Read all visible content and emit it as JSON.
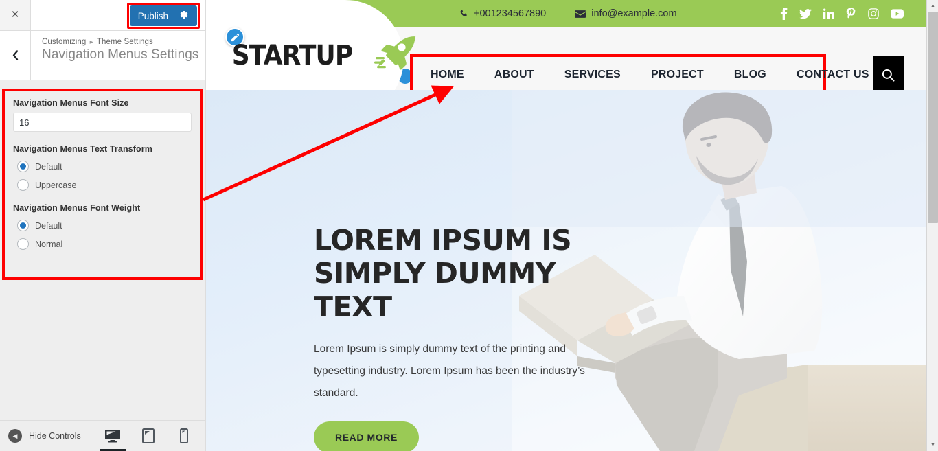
{
  "customizer": {
    "close_label": "×",
    "publish_label": "Publish",
    "gear_icon": "gear-icon",
    "back_icon": "chevron-left-icon",
    "breadcrumb_root": "Customizing",
    "breadcrumb_sep": "▸",
    "breadcrumb_parent": "Theme Settings",
    "panel_title": "Navigation Menus Settings",
    "accent_blue": "#2271b1",
    "annotation_color": "#fe0000",
    "controls": {
      "font_size": {
        "label": "Navigation Menus Font Size",
        "value": "16"
      },
      "text_transform": {
        "label": "Navigation Menus Text Transform",
        "options": [
          {
            "label": "Default",
            "checked": true
          },
          {
            "label": "Uppercase",
            "checked": false
          }
        ]
      },
      "font_weight": {
        "label": "Navigation Menus Font Weight",
        "options": [
          {
            "label": "Default",
            "checked": true
          },
          {
            "label": "Normal",
            "checked": false
          }
        ]
      }
    },
    "footer": {
      "hide_controls_label": "Hide Controls",
      "devices": [
        {
          "name": "desktop",
          "active": true
        },
        {
          "name": "tablet",
          "active": false
        },
        {
          "name": "mobile",
          "active": false
        }
      ]
    }
  },
  "preview": {
    "topbar": {
      "background": "#9aca55",
      "phone": "+001234567890",
      "email": "info@example.com",
      "social": [
        "facebook",
        "twitter",
        "linkedin",
        "pinterest",
        "instagram",
        "youtube"
      ]
    },
    "logo": {
      "text": "STARTUP",
      "badge_icon": "pencil-edit-icon",
      "rocket_icon": "rocket-icon"
    },
    "nav": {
      "items": [
        "HOME",
        "ABOUT",
        "SERVICES",
        "PROJECT",
        "BLOG",
        "CONTACT US"
      ],
      "search_icon": "search-icon"
    },
    "hero": {
      "title": "LOREM IPSUM IS SIMPLY DUMMY TEXT",
      "subtitle": "Lorem Ipsum is simply dummy text of the printing and typesetting industry. Lorem Ipsum has been the industry’s standard.",
      "cta_label": "READ MORE",
      "cta_color": "#9aca55"
    }
  },
  "scrollbar": {
    "up_arrow": "▲",
    "down_arrow": "▼"
  }
}
